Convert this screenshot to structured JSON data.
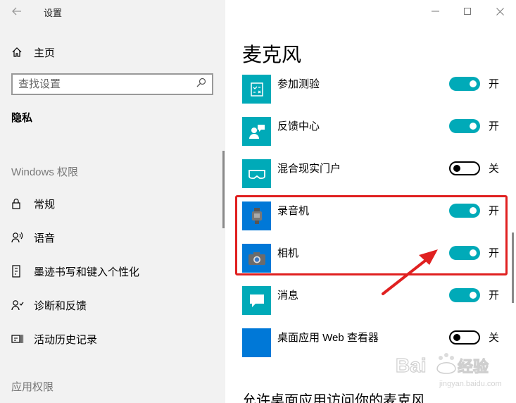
{
  "window": {
    "title": "设置",
    "controls": {
      "minimize": "—",
      "maximize": "☐",
      "close": "✕"
    }
  },
  "sidebar": {
    "home_label": "主页",
    "search_placeholder": "查找设置",
    "current_section": "隐私",
    "windows_permissions_header": "Windows 权限",
    "items": [
      {
        "label": "常规",
        "icon": "lock-icon"
      },
      {
        "label": "语音",
        "icon": "speech-icon"
      },
      {
        "label": "墨迹书写和键入个性化",
        "icon": "inking-icon"
      },
      {
        "label": "诊断和反馈",
        "icon": "diagnostics-icon"
      },
      {
        "label": "活动历史记录",
        "icon": "activity-history-icon"
      }
    ],
    "app_permissions_header": "应用权限"
  },
  "main": {
    "title": "麦克风",
    "apps": [
      {
        "name": "参加测验",
        "state": "开",
        "on": true,
        "tile_color": "#00aab8",
        "icon": "take-a-test-icon"
      },
      {
        "name": "反馈中心",
        "state": "开",
        "on": true,
        "tile_color": "#00aab8",
        "icon": "feedback-hub-icon"
      },
      {
        "name": "混合现实门户",
        "state": "关",
        "on": false,
        "tile_color": "#00aab8",
        "icon": "mixed-reality-icon"
      },
      {
        "name": "录音机",
        "state": "开",
        "on": true,
        "tile_color": "#0078d7",
        "icon": "voice-recorder-icon"
      },
      {
        "name": "相机",
        "state": "开",
        "on": true,
        "tile_color": "#0078d7",
        "icon": "camera-icon"
      },
      {
        "name": "消息",
        "state": "开",
        "on": true,
        "tile_color": "#00aab8",
        "icon": "messaging-icon"
      },
      {
        "name": "桌面应用 Web 查看器",
        "state": "关",
        "on": false,
        "tile_color": "#0078d7",
        "icon": "web-viewer-icon"
      }
    ],
    "section_heading": "允许桌面应用访问你的麦克风"
  },
  "watermark": {
    "text": "Baidu 经验",
    "sub": "jingyan.baidu.com"
  },
  "colors": {
    "accent": "#00aab8",
    "highlight": "#e02020"
  }
}
